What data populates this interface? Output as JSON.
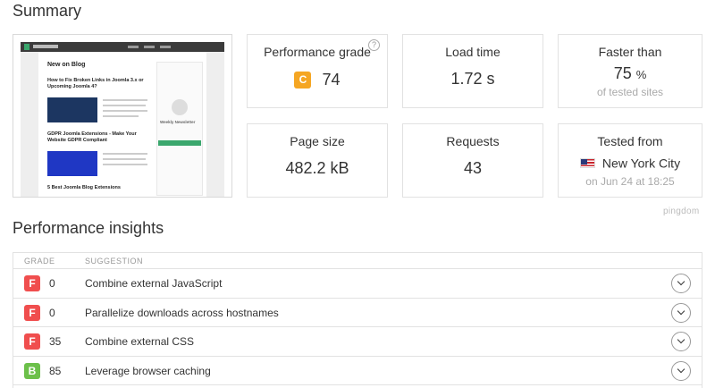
{
  "summary": {
    "title": "Summary",
    "preview": {
      "heading": "New on Blog",
      "post1": "How to Fix Broken Links in Joomla 3.x or Upcoming Joomla 4?",
      "post2": "GDPR Joomla Extensions - Make Your Website GDPR Compliant",
      "post3": "5 Best Joomla Blog Extensions",
      "side": "Weekly Newsletter"
    },
    "performance_grade": {
      "label": "Performance grade",
      "grade": "C",
      "score": "74",
      "help": "?"
    },
    "load_time": {
      "label": "Load time",
      "value": "1.72 s"
    },
    "faster_than": {
      "label": "Faster than",
      "value": "75",
      "unit": "%",
      "sub": "of tested sites"
    },
    "page_size": {
      "label": "Page size",
      "value": "482.2 kB"
    },
    "requests": {
      "label": "Requests",
      "value": "43"
    },
    "tested_from": {
      "label": "Tested from",
      "location": "New York City",
      "date": "on Jun 24 at 18:25"
    }
  },
  "brand": "pingdom",
  "insights": {
    "title": "Performance insights",
    "columns": {
      "grade": "GRADE",
      "suggestion": "SUGGESTION"
    },
    "rows": [
      {
        "grade": "F",
        "score": "0",
        "suggestion": "Combine external JavaScript"
      },
      {
        "grade": "F",
        "score": "0",
        "suggestion": "Parallelize downloads across hostnames"
      },
      {
        "grade": "F",
        "score": "35",
        "suggestion": "Combine external CSS"
      },
      {
        "grade": "B",
        "score": "85",
        "suggestion": "Leverage browser caching"
      }
    ]
  },
  "colors": {
    "grade_f": "#f04e4e",
    "grade_b": "#6cc04a",
    "grade_c": "#f5a623"
  }
}
